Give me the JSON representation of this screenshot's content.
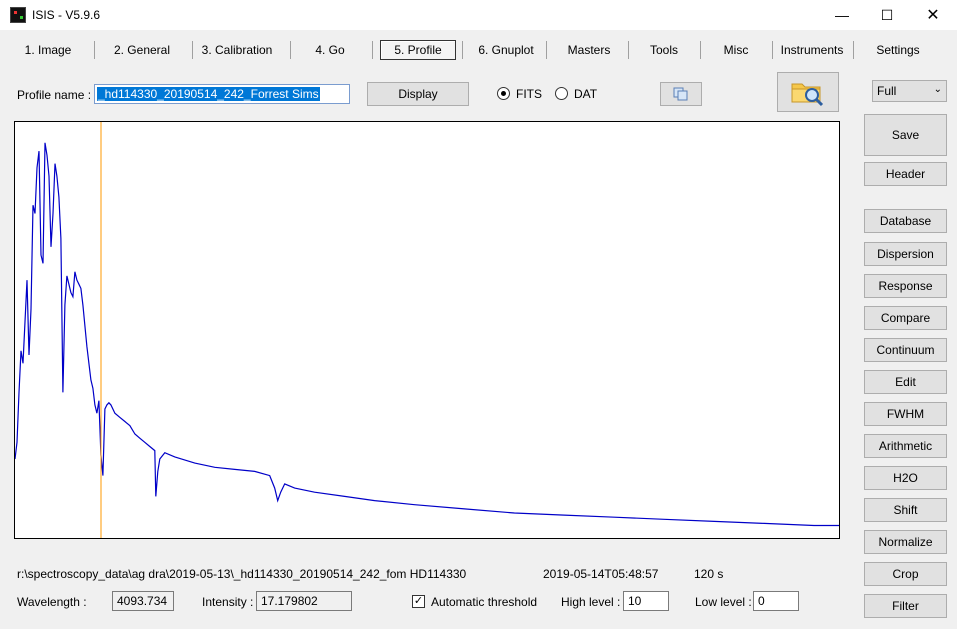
{
  "window": {
    "title": "ISIS - V5.9.6",
    "min": "—",
    "max": "☐",
    "close": "✕"
  },
  "tabs": [
    "1. Image",
    "2. General",
    "3. Calibration",
    "4. Go",
    "5. Profile",
    "6. Gnuplot",
    "Masters",
    "Tools",
    "Misc",
    "Instruments",
    "Settings"
  ],
  "active_tab": "5. Profile",
  "profile": {
    "label": "Profile name :",
    "value": "_hd114330_20190514_242_Forrest Sims",
    "display_button": "Display",
    "format_fits": "FITS",
    "format_dat": "DAT",
    "selected_format": "FITS"
  },
  "view_select": "Full",
  "sidebar": {
    "save": "Save",
    "header": "Header",
    "items": [
      "Database",
      "Dispersion",
      "Response",
      "Compare",
      "Continuum",
      "Edit",
      "FWHM",
      "Arithmetic",
      "H2O",
      "Shift",
      "Normalize",
      "Crop",
      "Filter"
    ]
  },
  "status": {
    "path": "r:\\spectroscopy_data\\ag dra\\2019-05-13\\_hd114330_20190514_242_fom HD114330",
    "date": "2019-05-14T05:48:57",
    "exposure": "120 s"
  },
  "readout": {
    "wavelength_label": "Wavelength :",
    "wavelength_value": "4093.734",
    "intensity_label": "Intensity :",
    "intensity_value": "17.179802",
    "auto_threshold_label": "Automatic threshold",
    "auto_threshold_checked": true,
    "high_level_label": "High level :",
    "high_level_value": "10",
    "low_level_label": "Low level :",
    "low_level_value": "0"
  },
  "colors": {
    "spectrum": "#0000c8",
    "cursor": "#ff9900",
    "selection": "#0078d7"
  },
  "chart_data": {
    "type": "line",
    "title": "",
    "xlabel": "",
    "ylabel": "",
    "axes_visible": false,
    "cursor_wavelength": 4093.734,
    "series": [
      {
        "x": [
          0,
          2,
          4,
          6,
          8,
          10,
          12,
          14,
          16,
          18,
          20,
          22,
          24,
          26,
          28,
          30,
          32,
          34,
          36,
          38,
          40,
          42,
          44,
          46,
          48,
          50,
          52,
          54,
          56,
          58,
          60,
          62,
          64,
          66,
          68,
          70,
          72,
          74,
          76,
          78,
          80,
          82,
          84,
          86,
          88,
          90,
          92,
          94,
          96,
          100,
          105,
          110,
          115,
          120,
          125,
          130,
          135,
          140,
          141,
          143,
          145,
          150,
          160,
          180,
          200,
          220,
          240,
          255,
          260,
          263,
          266,
          270,
          280,
          300,
          330,
          360,
          400,
          450,
          500,
          550,
          600,
          650,
          700,
          750,
          800,
          825
        ],
        "y": [
          0.19,
          0.23,
          0.35,
          0.45,
          0.42,
          0.52,
          0.62,
          0.44,
          0.55,
          0.8,
          0.78,
          0.89,
          0.93,
          0.68,
          0.66,
          0.95,
          0.92,
          0.87,
          0.7,
          0.78,
          0.9,
          0.87,
          0.82,
          0.72,
          0.35,
          0.56,
          0.63,
          0.61,
          0.59,
          0.58,
          0.64,
          0.62,
          0.61,
          0.6,
          0.56,
          0.51,
          0.46,
          0.42,
          0.38,
          0.36,
          0.32,
          0.3,
          0.33,
          0.2,
          0.15,
          0.31,
          0.32,
          0.325,
          0.32,
          0.3,
          0.29,
          0.28,
          0.27,
          0.25,
          0.24,
          0.23,
          0.22,
          0.21,
          0.1,
          0.16,
          0.19,
          0.205,
          0.195,
          0.18,
          0.17,
          0.165,
          0.16,
          0.15,
          0.12,
          0.09,
          0.11,
          0.13,
          0.12,
          0.11,
          0.1,
          0.09,
          0.08,
          0.07,
          0.06,
          0.055,
          0.05,
          0.045,
          0.04,
          0.035,
          0.03,
          0.03
        ]
      }
    ]
  }
}
